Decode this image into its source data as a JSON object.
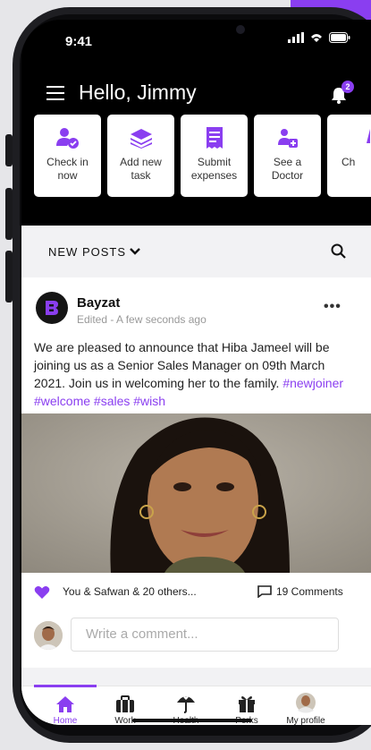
{
  "status_bar": {
    "time": "9:41"
  },
  "header": {
    "greeting": "Hello, Jimmy",
    "notification_count": "2"
  },
  "quick_actions": [
    {
      "line1": "Check in",
      "line2": "now",
      "icon": "user-check-icon"
    },
    {
      "line1": "Add new",
      "line2": "task",
      "icon": "layers-icon"
    },
    {
      "line1": "Submit",
      "line2": "expenses",
      "icon": "receipt-icon"
    },
    {
      "line1": "See a",
      "line2": "Doctor",
      "icon": "doctor-icon"
    },
    {
      "line1": "Ch",
      "line2": "",
      "icon": "partial-icon"
    }
  ],
  "feed": {
    "section_title": "NEW POSTS",
    "post": {
      "author": "Bayzat",
      "meta": "Edited - A few seconds ago",
      "body": "We are pleased to announce that Hiba Jameel will be joining us as a Senior Sales Manager on 09th March 2021. Join us in welcoming her to the family.",
      "hashtags": "#newjoiner #welcome #sales #wish",
      "likes_text": "You & Safwan & 20 others...",
      "comments_text": "19 Comments",
      "comment_placeholder": "Write a comment..."
    }
  },
  "tabbar": {
    "items": [
      {
        "label": "Home",
        "icon": "home-icon",
        "active": true
      },
      {
        "label": "Work",
        "icon": "briefcase-icon",
        "active": false
      },
      {
        "label": "Health",
        "icon": "umbrella-heart-icon",
        "active": false
      },
      {
        "label": "Perks",
        "icon": "gift-icon",
        "active": false
      },
      {
        "label": "My profile",
        "icon": "avatar-icon",
        "active": false
      }
    ]
  },
  "colors": {
    "accent": "#8a3ef0",
    "header_bg": "#000000",
    "feed_bg": "#f2f2f4"
  }
}
